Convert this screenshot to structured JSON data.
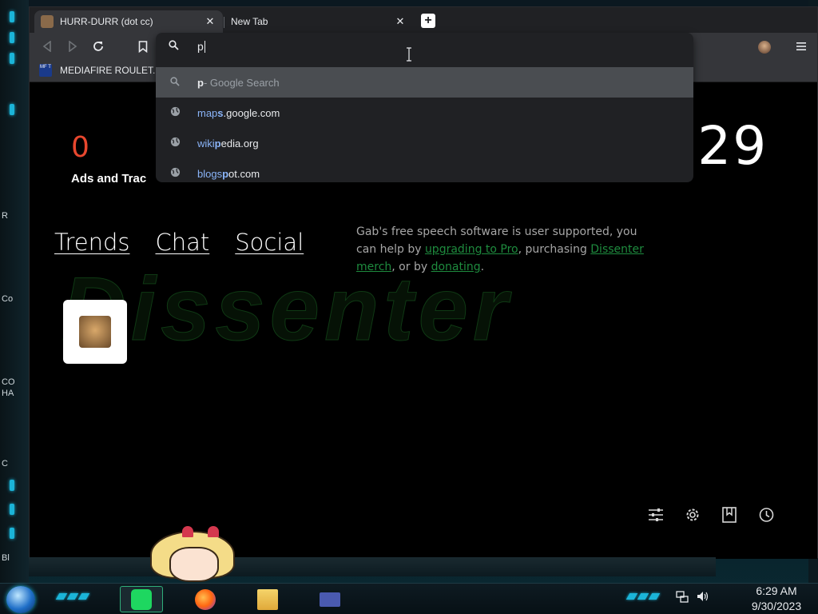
{
  "browser": {
    "tabs": [
      {
        "title": "HURR-DURR (dot cc)",
        "active": true
      },
      {
        "title": "New Tab",
        "active": false
      }
    ],
    "close_glyph": "✕",
    "new_tab_glyph": "+",
    "bookmarks": [
      {
        "icon_text": "MF T",
        "label": "MEDIAFIRE ROULET..."
      }
    ],
    "omnibox": {
      "value": "p",
      "suggestions": [
        {
          "type": "search",
          "icon": "search-icon",
          "typed": "p",
          "rest": " - Google Search",
          "selected": true
        },
        {
          "type": "url",
          "icon": "globe-icon",
          "highlight": "map",
          "bold": "s",
          "rest": ".google.com",
          "full": "maps.google.com"
        },
        {
          "type": "url",
          "icon": "globe-icon",
          "highlight": "wiki",
          "bold": "p",
          "rest": "edia.org",
          "full": "wikipedia.org"
        },
        {
          "type": "url",
          "icon": "globe-icon",
          "highlight": "blogs",
          "bold": "p",
          "rest": "ot.com",
          "full": "blogspot.com"
        }
      ]
    }
  },
  "page": {
    "ads_count": "0",
    "ads_label": "Ads and Trac",
    "clock": ":29",
    "background_word": "Dissenter",
    "nav": [
      "Trends",
      "Chat",
      "Social"
    ],
    "support": {
      "p1": "Gab's free speech software is user supported, you can help by ",
      "link1": "upgrading to Pro",
      "p2": ", purchasing ",
      "link2": "Dissenter merch",
      "p3": ", or by ",
      "link3": "donating",
      "p4": "."
    }
  },
  "taskbar": {
    "time": "6:29 AM",
    "date": "9/30/2023"
  },
  "desktop_labels": [
    "R",
    "Co",
    "CO",
    "HA",
    "C",
    "Bl"
  ],
  "colors": {
    "accent": "#1bb4d8",
    "ads_count": "#e8472e",
    "link_green": "#1e8b3e",
    "url_highlight": "#8ab4f8"
  }
}
